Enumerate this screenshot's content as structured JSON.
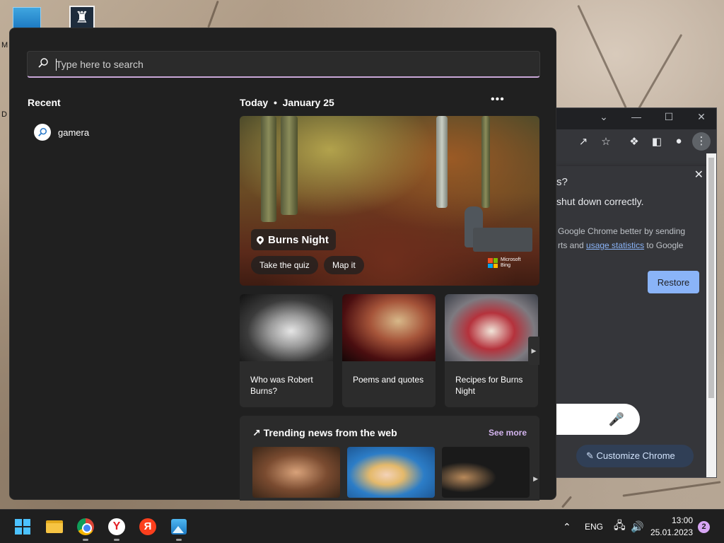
{
  "desktop": {
    "letters": [
      "M",
      "D"
    ]
  },
  "search": {
    "placeholder": "Type here to search",
    "value": ""
  },
  "recent": {
    "heading": "Recent",
    "items": [
      {
        "label": "gamera",
        "icon": "search-icon"
      }
    ]
  },
  "today": {
    "heading": "Today  •  January 25",
    "more": "•••"
  },
  "hero": {
    "title": "Burns Night",
    "buttons": [
      "Take the quiz",
      "Map it"
    ],
    "credit": [
      "Microsoft",
      "Bing"
    ]
  },
  "cards": [
    {
      "label": "Who was Robert Burns?"
    },
    {
      "label": "Poems and quotes"
    },
    {
      "label": "Recipes for Burns Night"
    }
  ],
  "trending": {
    "heading": "Trending news from the web",
    "see_more": "See more"
  },
  "chrome_window": {
    "popup_title": "s?",
    "popup_sub": "shut down correctly.",
    "popup_body_1": "Google Chrome better by sending",
    "popup_body_2": "rts and",
    "popup_link": "usage statistics",
    "popup_body_3": "to Google",
    "restore_label": "Restore",
    "customize_label": "Customize Chrome"
  },
  "taskbar": {
    "language": "ENG",
    "time": "13:00",
    "date": "25.01.2023",
    "notifications": "2",
    "apps": [
      "start",
      "file-explorer",
      "chrome",
      "yandex-browser",
      "yandex",
      "photos"
    ]
  },
  "colors": {
    "panel_bg": "#202020",
    "accent_see_more": "#d4b5ef",
    "search_underline": "#c9a7d8",
    "restore_btn": "#8ab4f8"
  }
}
